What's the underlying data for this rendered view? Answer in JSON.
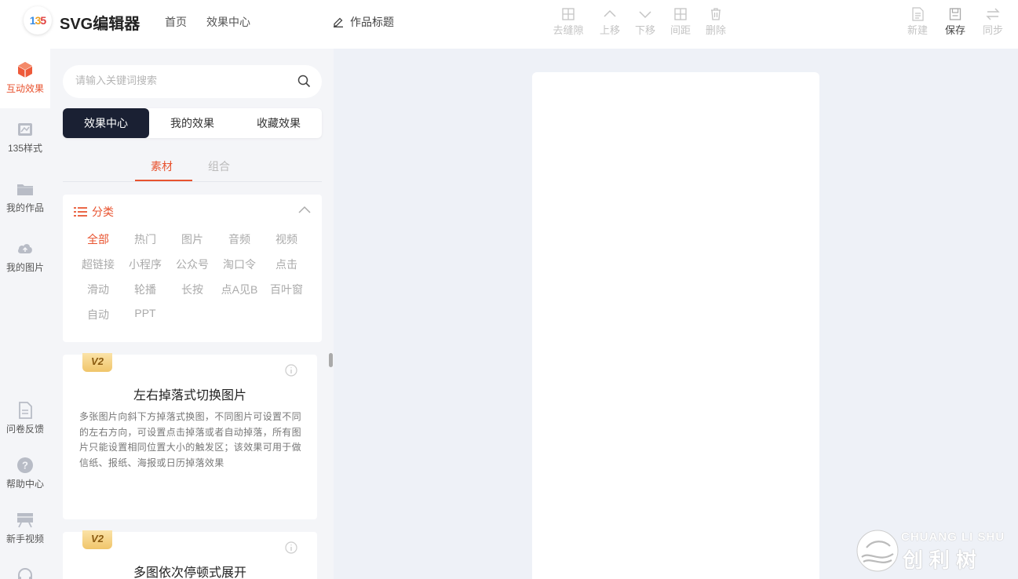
{
  "header": {
    "logo_text": [
      "1",
      "3",
      "5"
    ],
    "app_title": "SVG编辑器",
    "nav": [
      "首页",
      "效果中心"
    ],
    "work_title": "作品标题",
    "tools": [
      {
        "label": "去缝隙",
        "icon": "grid-plus-icon"
      },
      {
        "label": "上移",
        "icon": "chevron-up-icon"
      },
      {
        "label": "下移",
        "icon": "chevron-down-icon"
      },
      {
        "label": "间距",
        "icon": "spacing-icon"
      },
      {
        "label": "删除",
        "icon": "trash-icon"
      }
    ],
    "actions": [
      {
        "label": "新建",
        "icon": "new-file-icon"
      },
      {
        "label": "保存",
        "icon": "save-icon"
      },
      {
        "label": "同步",
        "icon": "sync-icon"
      }
    ]
  },
  "rail": {
    "items": [
      {
        "label": "互动效果",
        "icon": "cube-icon",
        "active": true
      },
      {
        "label": "135样式",
        "icon": "style-icon"
      },
      {
        "label": "我的作品",
        "icon": "folder-icon"
      },
      {
        "label": "我的图片",
        "icon": "cloud-upload-icon"
      }
    ],
    "bottom_items": [
      {
        "label": "问卷反馈",
        "icon": "survey-icon"
      },
      {
        "label": "帮助中心",
        "icon": "help-icon"
      },
      {
        "label": "新手视频",
        "icon": "video-icon"
      }
    ]
  },
  "panel": {
    "search_placeholder": "请输入关键词搜索",
    "tabs": [
      "效果中心",
      "我的效果",
      "收藏效果"
    ],
    "subtabs": [
      "素材",
      "组合"
    ],
    "category_title": "分类",
    "categories": [
      [
        "全部",
        "热门",
        "图片",
        "音频",
        "视频"
      ],
      [
        "超链接",
        "小程序",
        "公众号",
        "淘口令",
        "点击"
      ],
      [
        "滑动",
        "轮播",
        "长按",
        "点A见B",
        "百叶窗"
      ],
      [
        "自动",
        "PPT"
      ]
    ],
    "effects": [
      {
        "badge": "V2",
        "title": "左右掉落式切换图片",
        "description": "多张图片向斜下方掉落式换图，不同图片可设置不同的左右方向，可设置点击掉落或者自动掉落，所有图片只能设置相同位置大小的触发区；该效果可用于做信纸、报纸、海报或日历掉落效果"
      },
      {
        "badge": "V2",
        "title": "多图依次停顿式展开",
        "description": ""
      }
    ]
  },
  "watermark": {
    "en": "CHUANG LI SHU",
    "cn": "创利树"
  },
  "colors": {
    "accent": "#e8532f",
    "dark_tab": "#1a2033",
    "background": "#eef1f7"
  }
}
